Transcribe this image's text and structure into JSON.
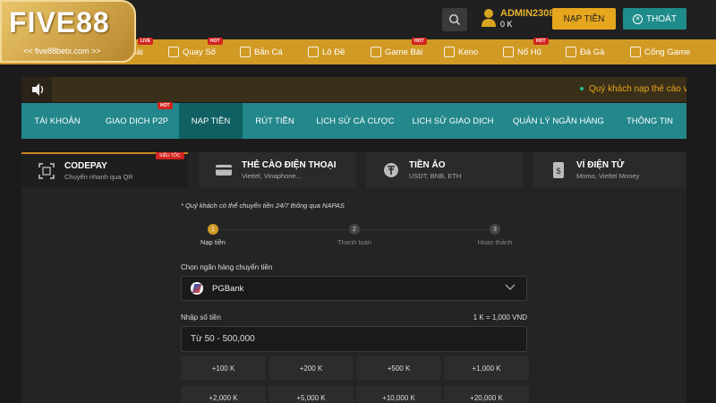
{
  "logo": {
    "text": "FIVE88",
    "sub": "<< five88betx.com >>"
  },
  "user": {
    "name": "ADMIN2308",
    "balance": "0 K"
  },
  "buttons": {
    "deposit": "NẠP TIỀN",
    "logout": "THOÁT"
  },
  "games": [
    {
      "label": "Bài",
      "tag": "LIVE"
    },
    {
      "label": "Quay Số",
      "tag": "HOT"
    },
    {
      "label": "Bắn Cá",
      "tag": ""
    },
    {
      "label": "Lô Đề",
      "tag": ""
    },
    {
      "label": "Game Bài",
      "tag": "HOT"
    },
    {
      "label": "Keno",
      "tag": ""
    },
    {
      "label": "Nổ Hũ",
      "tag": "HOT"
    },
    {
      "label": "Đá Gà",
      "tag": ""
    },
    {
      "label": "Cổng Game",
      "tag": ""
    }
  ],
  "notice": "Quý khách nạp thẻ cào vui lò",
  "tabs": [
    "TÀI KHOẢN",
    "GIAO DỊCH P2P",
    "NẠP TIỀN",
    "RÚT TIỀN",
    "LỊCH SỬ CÁ CƯỢC",
    "LỊCH SỬ GIAO DỊCH",
    "QUẢN LÝ NGÂN HÀNG",
    "THÔNG TIN"
  ],
  "tab_badge": "HOT",
  "methods": [
    {
      "title": "CODEPAY",
      "sub": "Chuyển nhanh qua QR",
      "badge": "SIÊU TỐC"
    },
    {
      "title": "THẺ CÀO ĐIỆN THOẠI",
      "sub": "Viettel, Vinaphone..."
    },
    {
      "title": "TIỀN ẢO",
      "sub": "USDT, BNB, ETH"
    },
    {
      "title": "VÍ ĐIỆN TỬ",
      "sub": "Momo, Viettel Money"
    }
  ],
  "note": "* Quý khách có thể chuyển tiền 24/7 thông qua NAPAS",
  "steps": [
    {
      "num": "1",
      "label": "Nạp tiền"
    },
    {
      "num": "2",
      "label": "Thanh toán"
    },
    {
      "num": "3",
      "label": "Hoàn thành"
    }
  ],
  "bank_label": "Chọn ngân hàng chuyển tiền",
  "bank_selected": "PGBank",
  "amount_label": "Nhập số tiền",
  "rate": "1 K = 1,000 VND",
  "amount_placeholder": "Từ 50 - 500,000",
  "quick": [
    "+100 K",
    "+200 K",
    "+500 K",
    "+1,000 K",
    "+2,000 K",
    "+5,000 K",
    "+10,000 K",
    "+20,000 K"
  ],
  "colors": {
    "gold": "#d19a25",
    "teal": "#23878b",
    "teal_active": "#0f5f63",
    "hot": "#d2241f"
  }
}
